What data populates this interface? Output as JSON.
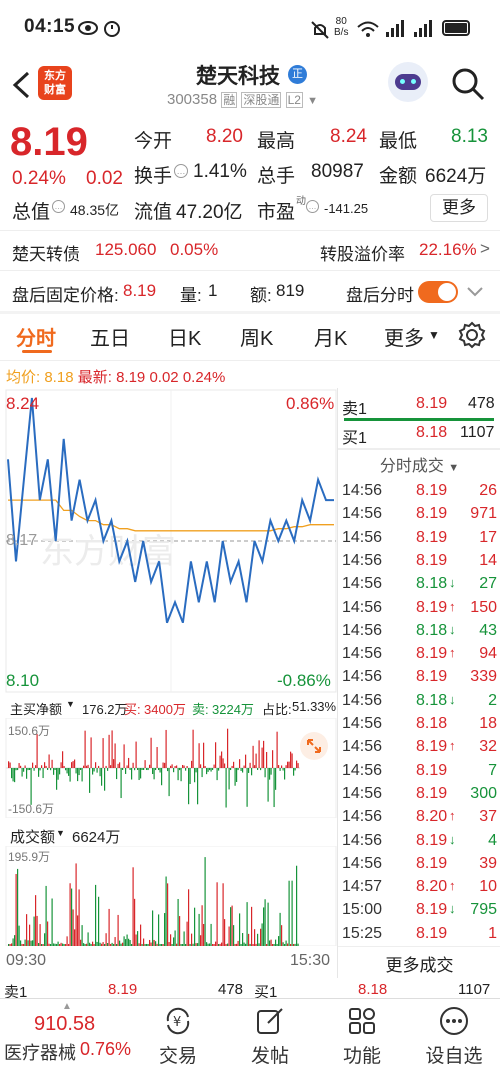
{
  "status": {
    "time": "04:15",
    "net_speed_top": "80",
    "net_speed_bottom": "B/s",
    "battery": "94"
  },
  "header": {
    "title": "楚天科技",
    "badge": "正",
    "code": "300358",
    "tag1": "融",
    "tag2": "深股通",
    "tag3": "L2",
    "logo_line1": "东方",
    "logo_line2": "财富"
  },
  "quote": {
    "price": "8.19",
    "pct": "0.24%",
    "chg": "0.02",
    "open_label": "今开",
    "open": "8.20",
    "high_label": "最高",
    "high": "8.24",
    "low_label": "最低",
    "low": "8.13",
    "turnover_label": "换手",
    "turnover": "1.41%",
    "vol_label": "总手",
    "vol": "80987",
    "amount_label": "金额",
    "amount": "6624万",
    "mcap_label": "总值",
    "mcap": "48.35亿",
    "float_label": "流值",
    "float": "47.20亿",
    "pe_label": "市盈",
    "pe_sup": "动",
    "pe": "-141.25",
    "more": "更多"
  },
  "convert": {
    "name": "楚天转债",
    "price": "125.060",
    "pct": "0.05%",
    "premium_label": "转股溢价率",
    "premium": "22.16%",
    "arrow": ">"
  },
  "after": {
    "fixed_label": "盘后固定价格:",
    "fixed": "8.19",
    "qty_label": "量:",
    "qty": "1",
    "amt_label": "额:",
    "amt": "819",
    "ts_label": "盘后分时"
  },
  "tabs": [
    "分时",
    "五日",
    "日K",
    "周K",
    "月K",
    "更多"
  ],
  "avgline": {
    "avg_label": "均价:",
    "avg": "8.18",
    "latest_label": "最新:",
    "latest": "8.19",
    "chg": "0.02",
    "pct": "0.24%"
  },
  "chart": {
    "top_price": "8.24",
    "top_pct": "0.86%",
    "bottom_price": "8.10",
    "bottom_pct": "-0.86%",
    "mid_price": "8.17",
    "start_time": "09:30",
    "end_time": "15:30",
    "watermark": "东方财富"
  },
  "chart_data": {
    "type": "line",
    "series": [
      {
        "values": [
          8.21,
          8.16,
          8.2,
          8.24,
          8.19,
          8.21,
          8.17,
          8.22,
          8.18,
          8.2,
          8.18,
          8.19,
          8.17,
          8.18,
          8.16,
          8.17,
          8.15,
          8.17,
          8.15,
          8.16,
          8.13,
          8.14,
          8.13,
          8.16,
          8.14,
          8.16,
          8.14,
          8.17,
          8.15,
          8.16,
          8.14,
          8.17,
          8.16,
          8.18,
          8.17,
          8.18,
          8.17,
          8.19,
          8.18,
          8.2,
          8.19,
          8.19
        ]
      },
      {
        "values": [
          8.19,
          8.19,
          8.19,
          8.19,
          8.19,
          8.19,
          8.19,
          8.185,
          8.185,
          8.182,
          8.18,
          8.18,
          8.178,
          8.178,
          8.176,
          8.176,
          8.175,
          8.175,
          8.175,
          8.175,
          8.175,
          8.175,
          8.175,
          8.175,
          8.175,
          8.175,
          8.175,
          8.175,
          8.175,
          8.175,
          8.175,
          8.175,
          8.175,
          8.175,
          8.176,
          8.176,
          8.177,
          8.177,
          8.178,
          8.178,
          8.178,
          8.178
        ]
      }
    ],
    "ylim": [
      8.1,
      8.24
    ]
  },
  "netflow": {
    "label": "主买净额",
    "value": "176.2万",
    "buy_label": "买:",
    "buy": "3400万",
    "sell_label": "卖:",
    "sell": "3224万",
    "ratio_label": "占比:",
    "ratio": "51.33%",
    "top": "150.6万",
    "bottom": "-150.6万"
  },
  "volume": {
    "label": "成交额",
    "value": "6624万",
    "top": "195.9万"
  },
  "orderbook": {
    "sell_label": "卖1",
    "sell_price": "8.19",
    "sell_vol": "478",
    "buy_label": "买1",
    "buy_price": "8.18",
    "buy_vol": "1107",
    "title": "分时成交",
    "more": "更多成交"
  },
  "trades": [
    {
      "t": "14:56",
      "p": "8.19",
      "v": "26",
      "c": "red",
      "a": ""
    },
    {
      "t": "14:56",
      "p": "8.19",
      "v": "971",
      "c": "red",
      "a": ""
    },
    {
      "t": "14:56",
      "p": "8.19",
      "v": "17",
      "c": "red",
      "a": ""
    },
    {
      "t": "14:56",
      "p": "8.19",
      "v": "14",
      "c": "red",
      "a": ""
    },
    {
      "t": "14:56",
      "p": "8.18",
      "v": "27",
      "c": "green",
      "a": "↓"
    },
    {
      "t": "14:56",
      "p": "8.19",
      "v": "150",
      "c": "red",
      "a": "↑"
    },
    {
      "t": "14:56",
      "p": "8.18",
      "v": "43",
      "c": "green",
      "a": "↓"
    },
    {
      "t": "14:56",
      "p": "8.19",
      "v": "94",
      "c": "red",
      "a": "↑"
    },
    {
      "t": "14:56",
      "p": "8.19",
      "v": "339",
      "c": "red",
      "a": ""
    },
    {
      "t": "14:56",
      "p": "8.18",
      "v": "2",
      "c": "green",
      "a": "↓"
    },
    {
      "t": "14:56",
      "p": "8.18",
      "v": "18",
      "c": "red",
      "a": ""
    },
    {
      "t": "14:56",
      "p": "8.19",
      "v": "32",
      "c": "red",
      "a": "↑"
    },
    {
      "t": "14:56",
      "p": "8.19",
      "v": "7",
      "c": "green",
      "a": ""
    },
    {
      "t": "14:56",
      "p": "8.19",
      "v": "300",
      "c": "green",
      "a": ""
    },
    {
      "t": "14:56",
      "p": "8.20",
      "v": "37",
      "c": "red",
      "a": "↑"
    },
    {
      "t": "14:56",
      "p": "8.19",
      "v": "4",
      "c": "green",
      "a": "↓"
    },
    {
      "t": "14:56",
      "p": "8.19",
      "v": "39",
      "c": "red",
      "a": ""
    },
    {
      "t": "14:57",
      "p": "8.20",
      "v": "10",
      "c": "red",
      "a": "↑"
    },
    {
      "t": "15:00",
      "p": "8.19",
      "v": "795",
      "c": "green",
      "a": "↓"
    },
    {
      "t": "15:25",
      "p": "8.19",
      "v": "1",
      "c": "red",
      "a": ""
    }
  ],
  "bottombar": {
    "sell_label": "卖1",
    "sell_price": "8.19",
    "sell_vol": "478",
    "buy_label": "买1",
    "buy_price": "8.18",
    "buy_vol": "1107",
    "index_value": "910.58",
    "index_name": "医疗器械",
    "index_pct": "0.76%"
  },
  "nav": [
    "交易",
    "发帖",
    "功能",
    "设自选"
  ],
  "colors": {
    "up": "#d8262a",
    "down": "#16933a",
    "accent": "#f06a1e",
    "line": "#2a6cc0",
    "avg": "#f0a020"
  }
}
